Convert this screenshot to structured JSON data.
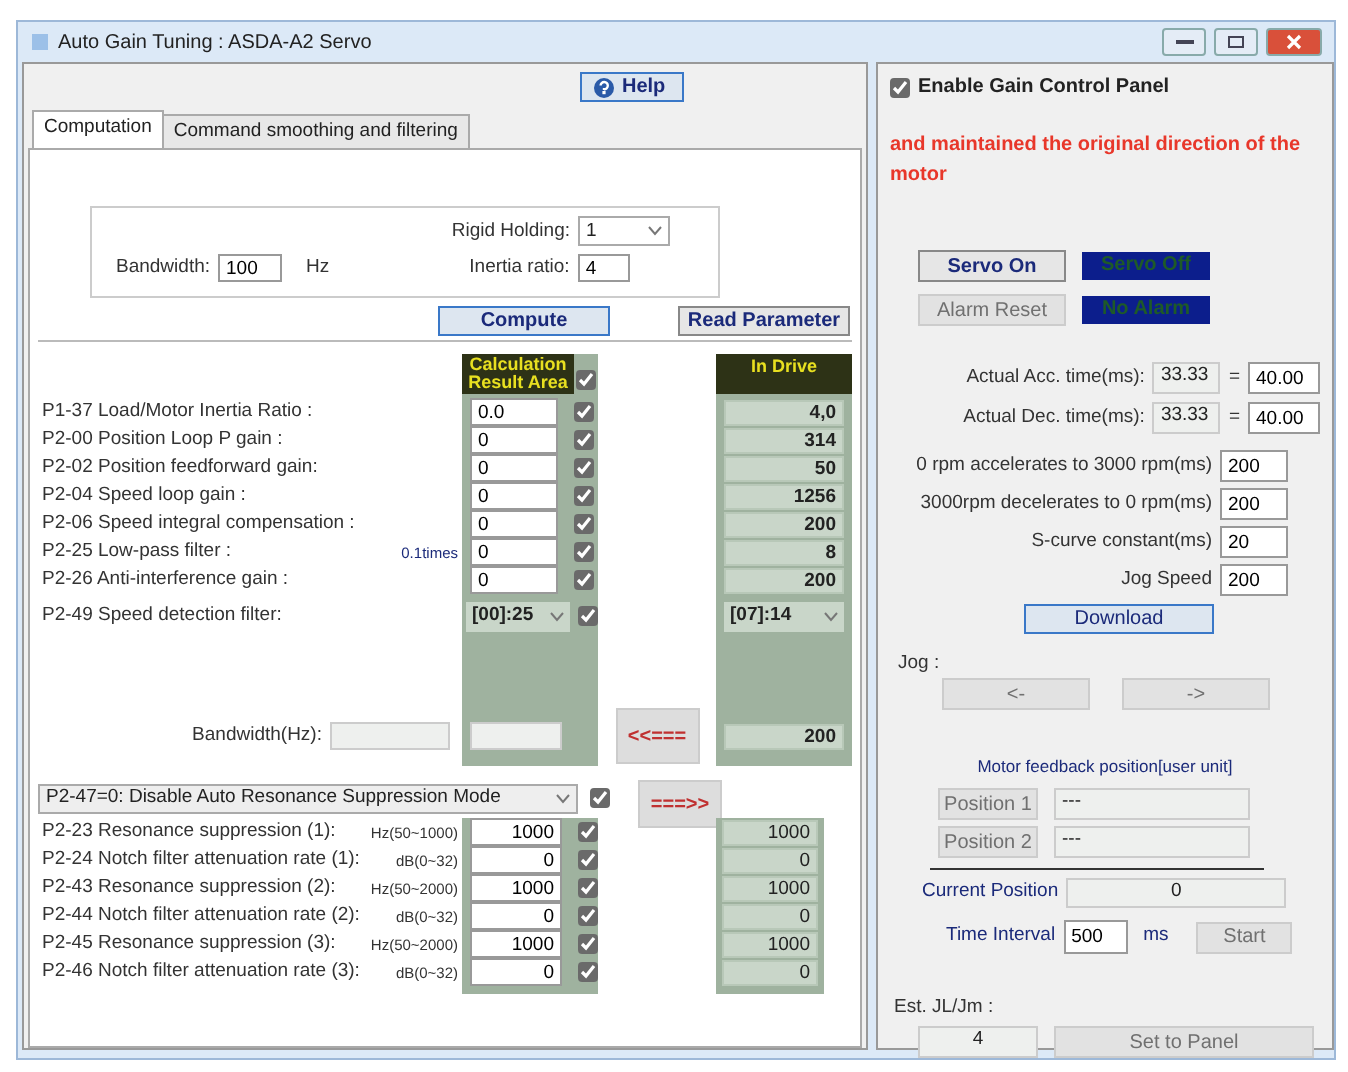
{
  "window": {
    "title": "Auto Gain Tuning : ASDA-A2 Servo"
  },
  "help_button": "Help",
  "tabs": [
    {
      "label": "Computation",
      "selected": true
    },
    {
      "label": "Command smoothing and filtering",
      "selected": false
    }
  ],
  "settings": {
    "rigid_holding_label": "Rigid Holding:",
    "rigid_holding": "1",
    "bandwidth_label": "Bandwidth:",
    "bandwidth": "100",
    "bandwidth_unit": "Hz",
    "inertia_label": "Inertia ratio:",
    "inertia": "4"
  },
  "compute_button": "Compute",
  "read_parameter_button": "Read Parameter",
  "calc_header": "Calculation Result Area",
  "calc_all_checked": true,
  "drive_header": "In Drive",
  "gain_params": [
    {
      "label": "P1-37 Load/Motor Inertia Ratio :",
      "value": "0.0",
      "checked": true,
      "drive": "4,0"
    },
    {
      "label": "P2-00 Position Loop P gain :",
      "value": "0",
      "checked": true,
      "drive": "314"
    },
    {
      "label": "P2-02 Position feedforward gain:",
      "value": "0",
      "checked": true,
      "drive": "50"
    },
    {
      "label": "P2-04 Speed loop gain :",
      "value": "0",
      "checked": true,
      "drive": "1256"
    },
    {
      "label": "P2-06 Speed integral compensation :",
      "value": "0",
      "checked": true,
      "drive": "200"
    },
    {
      "label": "P2-25 Low-pass filter :",
      "unit": "0.1times",
      "value": "0",
      "checked": true,
      "drive": "8"
    },
    {
      "label": "P2-26 Anti-interference gain :",
      "value": "0",
      "checked": true,
      "drive": "200"
    }
  ],
  "speed_filter": {
    "label": "P2-49 Speed detection filter:",
    "value": "[00]:25",
    "checked": true,
    "drive": "[07]:14"
  },
  "bandwidth_row": {
    "label": "Bandwidth(Hz):",
    "drive": "200"
  },
  "read_arrow": "<<===",
  "write_arrow": "===>>",
  "resonance": {
    "mode": "P2-47=0: Disable Auto Resonance Suppression Mode",
    "checked": true,
    "params": [
      {
        "label": "P2-23 Resonance suppression (1):",
        "unit": "Hz(50~1000)",
        "value": "1000",
        "checked": true,
        "drive": "1000"
      },
      {
        "label": "P2-24 Notch filter attenuation rate (1):",
        "unit": "dB(0~32)",
        "value": "0",
        "checked": true,
        "drive": "0"
      },
      {
        "label": "P2-43 Resonance suppression (2):",
        "unit": "Hz(50~2000)",
        "value": "1000",
        "checked": true,
        "drive": "1000"
      },
      {
        "label": "P2-44 Notch filter attenuation rate (2):",
        "unit": "dB(0~32)",
        "value": "0",
        "checked": true,
        "drive": "0"
      },
      {
        "label": "P2-45 Resonance suppression (3):",
        "unit": "Hz(50~2000)",
        "value": "1000",
        "checked": true,
        "drive": "1000"
      },
      {
        "label": "P2-46 Notch filter attenuation rate (3):",
        "unit": "dB(0~32)",
        "value": "0",
        "checked": true,
        "drive": "0"
      }
    ]
  },
  "enable_panel": {
    "label": "Enable Gain Control Panel",
    "checked": true
  },
  "message": "and maintained the original direction of the motor",
  "servo_on_button": {
    "label": "Servo On",
    "disabled": false
  },
  "servo_status": "Servo Off",
  "alarm_reset_button": {
    "label": "Alarm Reset",
    "disabled": true
  },
  "alarm_status": "No Alarm",
  "accel_times": [
    {
      "label": "Actual Acc. time(ms):",
      "actual": "33.33",
      "sign": "=",
      "value": "40.00"
    },
    {
      "label": "Actual Dec. time(ms):",
      "actual": "33.33",
      "sign": "=",
      "value": "40.00"
    }
  ],
  "motion": [
    {
      "label": "0 rpm accelerates to 3000 rpm(ms)",
      "value": "200"
    },
    {
      "label": "3000rpm decelerates to 0 rpm(ms)",
      "value": "200"
    },
    {
      "label": "S-curve constant(ms)",
      "value": "20"
    },
    {
      "label": "Jog Speed",
      "value": "200"
    }
  ],
  "download_button": "Download",
  "jog": {
    "label": "Jog :",
    "buttons": [
      {
        "label": "<-",
        "disabled": true
      },
      {
        "label": "->",
        "disabled": true
      }
    ]
  },
  "feedback": {
    "title": "Motor feedback position[user unit]",
    "positions": [
      {
        "label": "Position 1",
        "value": "---",
        "disabled": true
      },
      {
        "label": "Position 2",
        "value": "---",
        "disabled": true
      }
    ]
  },
  "current_position": {
    "label": "Current Position",
    "value": "0"
  },
  "time_interval": {
    "label": "Time Interval",
    "value": "500",
    "unit": "ms",
    "button": {
      "label": "Start",
      "disabled": true
    }
  },
  "estimate": {
    "label": "Est. JL/Jm :",
    "value": "4",
    "button": {
      "label": "Set to Panel",
      "disabled": true
    }
  }
}
